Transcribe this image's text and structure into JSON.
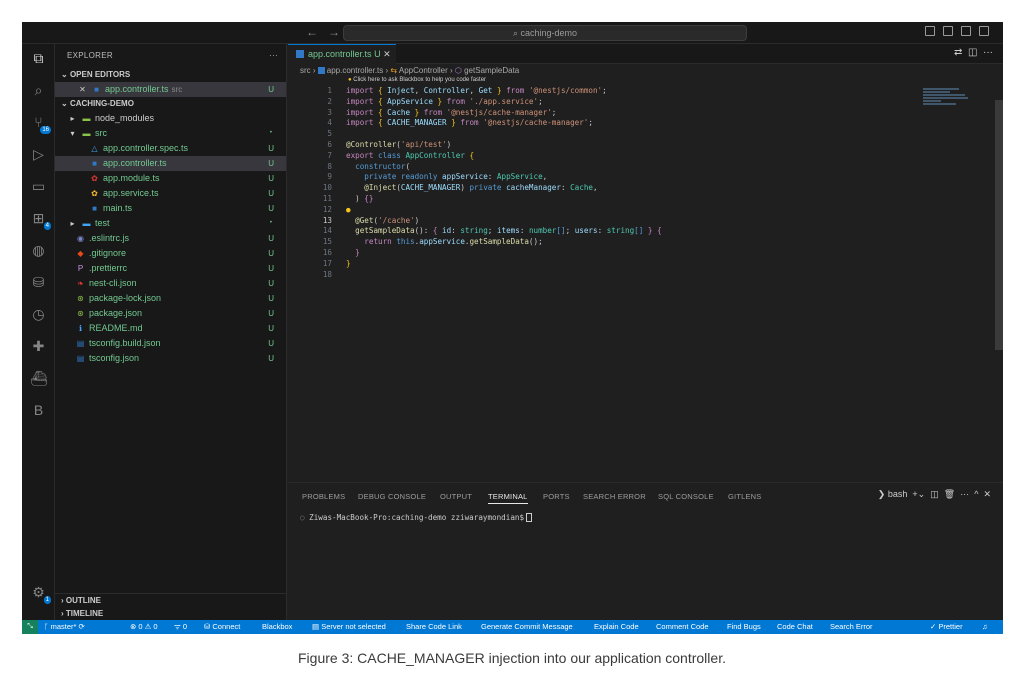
{
  "titlebar": {
    "search": "⌕ caching-demo",
    "back_icon": "←",
    "forward_icon": "→"
  },
  "explorer": {
    "title": "EXPLORER",
    "more": "···",
    "open_editors_label": "OPEN EDITORS",
    "open_editor": {
      "name": "app.controller.ts",
      "folder": "src",
      "status": "U"
    },
    "project_label": "CACHING-DEMO",
    "tree": [
      {
        "name": "node_modules",
        "icon": "▸",
        "status": ""
      },
      {
        "name": "src",
        "icon": "▾",
        "status": "•"
      },
      {
        "name": "app.controller.spec.ts",
        "icon": "△",
        "status": "U"
      },
      {
        "name": "app.controller.ts",
        "icon": "■",
        "status": "U"
      },
      {
        "name": "app.module.ts",
        "icon": "✿",
        "status": "U"
      },
      {
        "name": "app.service.ts",
        "icon": "✿",
        "status": "U"
      },
      {
        "name": "main.ts",
        "icon": "■",
        "status": "U"
      },
      {
        "name": "test",
        "icon": "▸",
        "status": "•"
      },
      {
        "name": ".eslintrc.js",
        "icon": "◉",
        "status": "U"
      },
      {
        "name": ".gitignore",
        "icon": "◆",
        "status": "U"
      },
      {
        "name": ".prettierrc",
        "icon": "P",
        "status": "U"
      },
      {
        "name": "nest-cli.json",
        "icon": "❧",
        "status": "U"
      },
      {
        "name": "package-lock.json",
        "icon": "⊛",
        "status": "U"
      },
      {
        "name": "package.json",
        "icon": "⊛",
        "status": "U"
      },
      {
        "name": "README.md",
        "icon": "ℹ",
        "status": "U"
      },
      {
        "name": "tsconfig.build.json",
        "icon": "▤",
        "status": "U"
      },
      {
        "name": "tsconfig.json",
        "icon": "▤",
        "status": "U"
      }
    ],
    "outline_label": "OUTLINE",
    "timeline_label": "TIMELINE"
  },
  "editor": {
    "tab_label": "app.controller.ts",
    "tab_status": "U",
    "breadcrumb": {
      "folder": "src",
      "file": "app.controller.ts",
      "class": "AppController",
      "method": "getSampleData"
    },
    "hint": "Click here to ask Blackbox to help you code faster",
    "current_line": 13
  },
  "panel": {
    "tabs": [
      "PROBLEMS",
      "DEBUG CONSOLE",
      "OUTPUT",
      "TERMINAL",
      "PORTS",
      "SEARCH ERROR",
      "SQL CONSOLE",
      "GITLENS"
    ],
    "active_tab": "TERMINAL",
    "shell": "bash",
    "prompt": "Ziwas-MacBook-Pro:caching-demo zziwaraymondian$"
  },
  "statusbar": {
    "branch": "master*",
    "errors": "⊗ 0 ⚠ 0",
    "ports": "ᯤ 0",
    "connect": "Connect",
    "items": [
      "Blackbox",
      "Server not selected",
      "Share Code Link",
      "Generate Commit Message",
      "Explain Code",
      "Comment Code",
      "Find Bugs",
      "Code Chat",
      "Search Error"
    ],
    "prettier": "Prettier"
  },
  "caption": "Figure 3: CACHE_MANAGER injection into our application controller.",
  "colors": {
    "accent": "#0078d4",
    "untracked": "#73c991",
    "editor_bg": "#1f1f1f",
    "sidebar_bg": "#181818"
  }
}
